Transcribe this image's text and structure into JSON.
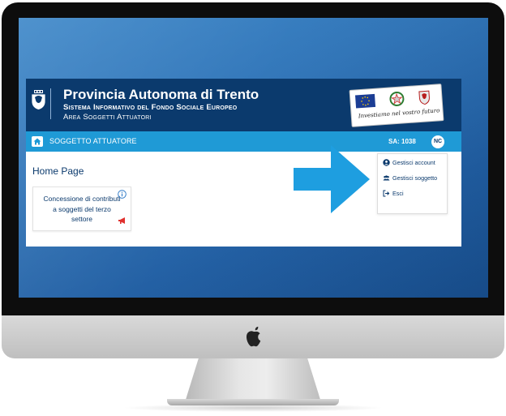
{
  "site": {
    "title": "Provincia Autonoma di Trento",
    "subtitle": "Sistema Informativo del Fondo Sociale Europeo",
    "area": "Area Soggetti Attuatori",
    "banner_motto": "Investiamo nel vostro futuro"
  },
  "navbar": {
    "label": "SOGGETTO ATTUATORE",
    "sa_label": "SA: 1038",
    "avatar": "NC"
  },
  "page": {
    "title": "Home Page"
  },
  "card": {
    "text": "Concessione di contributi a soggetti del terzo settore"
  },
  "menu": {
    "items": [
      {
        "label": "Gestisci account",
        "icon": "user-circle-icon"
      },
      {
        "label": "Gestisci soggetto",
        "icon": "users-icon"
      },
      {
        "label": "Esci",
        "icon": "sign-out-icon"
      }
    ]
  },
  "colors": {
    "header_bg": "#0b3a6d",
    "navbar_bg": "#1f9ad6",
    "arrow": "#1e9ee0",
    "alert": "#e0302d"
  }
}
